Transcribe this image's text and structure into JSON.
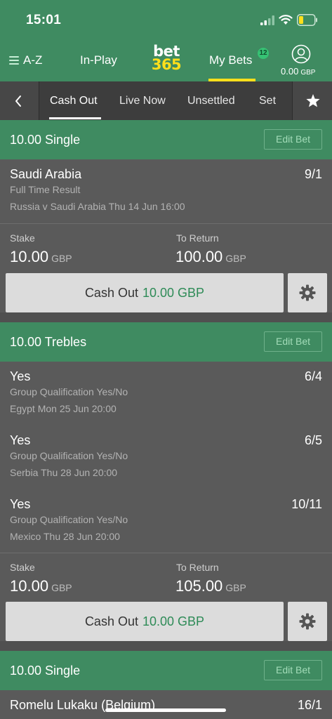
{
  "status_bar": {
    "time": "15:01"
  },
  "nav": {
    "az_label": "A-Z",
    "inplay_label": "In-Play",
    "logo_top": "bet",
    "logo_bottom": "365",
    "mybets_label": "My Bets",
    "mybets_badge": "12",
    "balance": "0.00",
    "balance_currency": "GBP"
  },
  "tabs": {
    "items": [
      {
        "label": "Cash Out"
      },
      {
        "label": "Live Now"
      },
      {
        "label": "Unsettled"
      },
      {
        "label": "Set"
      }
    ]
  },
  "colors": {
    "brand_green": "#3f8b61",
    "logo_yellow": "#ffdf1b",
    "cashout_green": "#2e8b57"
  },
  "bets": [
    {
      "header": "10.00  Single",
      "edit_label": "Edit Bet",
      "selections": [
        {
          "name": "Saudi Arabia",
          "odds": "9/1",
          "market": "Full Time Result",
          "event": "Russia v Saudi Arabia Thu 14 Jun 16:00"
        }
      ],
      "stake_label": "Stake",
      "stake": "10.00",
      "return_label": "To Return",
      "return": "100.00",
      "currency": "GBP",
      "cashout_label": "Cash Out",
      "cashout_amount": "10.00 GBP"
    },
    {
      "header": "10.00  Trebles",
      "edit_label": "Edit Bet",
      "selections": [
        {
          "name": "Yes",
          "odds": "6/4",
          "market": "Group Qualification Yes/No",
          "event": "Egypt Mon 25 Jun 20:00"
        },
        {
          "name": "Yes",
          "odds": "6/5",
          "market": "Group Qualification Yes/No",
          "event": "Serbia Thu 28 Jun 20:00"
        },
        {
          "name": "Yes",
          "odds": "10/11",
          "market": "Group Qualification Yes/No",
          "event": "Mexico Thu 28 Jun 20:00"
        }
      ],
      "stake_label": "Stake",
      "stake": "10.00",
      "return_label": "To Return",
      "return": "105.00",
      "currency": "GBP",
      "cashout_label": "Cash Out",
      "cashout_amount": "10.00 GBP"
    },
    {
      "header": "10.00  Single",
      "edit_label": "Edit Bet",
      "selections": [
        {
          "name": "Romelu Lukaku (Belgium)",
          "odds": "16/1"
        }
      ]
    }
  ]
}
